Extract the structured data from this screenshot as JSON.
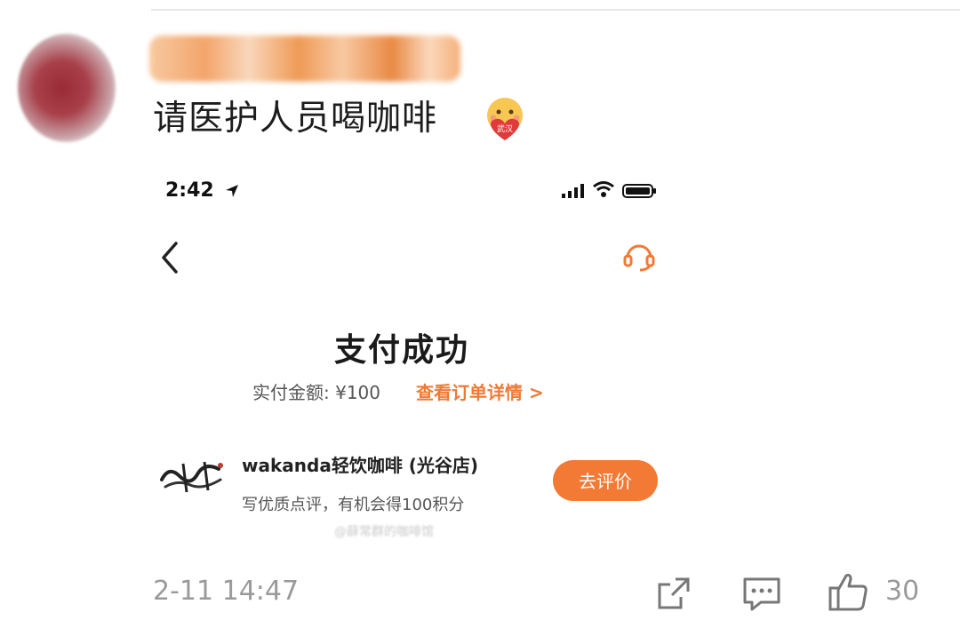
{
  "post": {
    "text": "请医护人员喝咖啡",
    "emoji_icon": "wuhan-heart-emoji-icon",
    "emoji_text": "武汉",
    "timestamp": "2-11 14:47",
    "like_count": "30"
  },
  "embedded_screenshot": {
    "status_bar": {
      "time": "2:42"
    },
    "title": "支付成功",
    "amount_text": "实付金额: ¥100",
    "order_link": "查看订单详情 >",
    "store": {
      "name": "wakanda轻饮咖啡 (光谷店)",
      "subtitle": "写优质点评，有机会得100积分",
      "review_button": "去评价"
    },
    "watermark": "@薛常群的咖啡馆"
  },
  "colors": {
    "accent": "#f27a35",
    "link": "#f07a35",
    "meta_gray": "#9a9a9a"
  }
}
